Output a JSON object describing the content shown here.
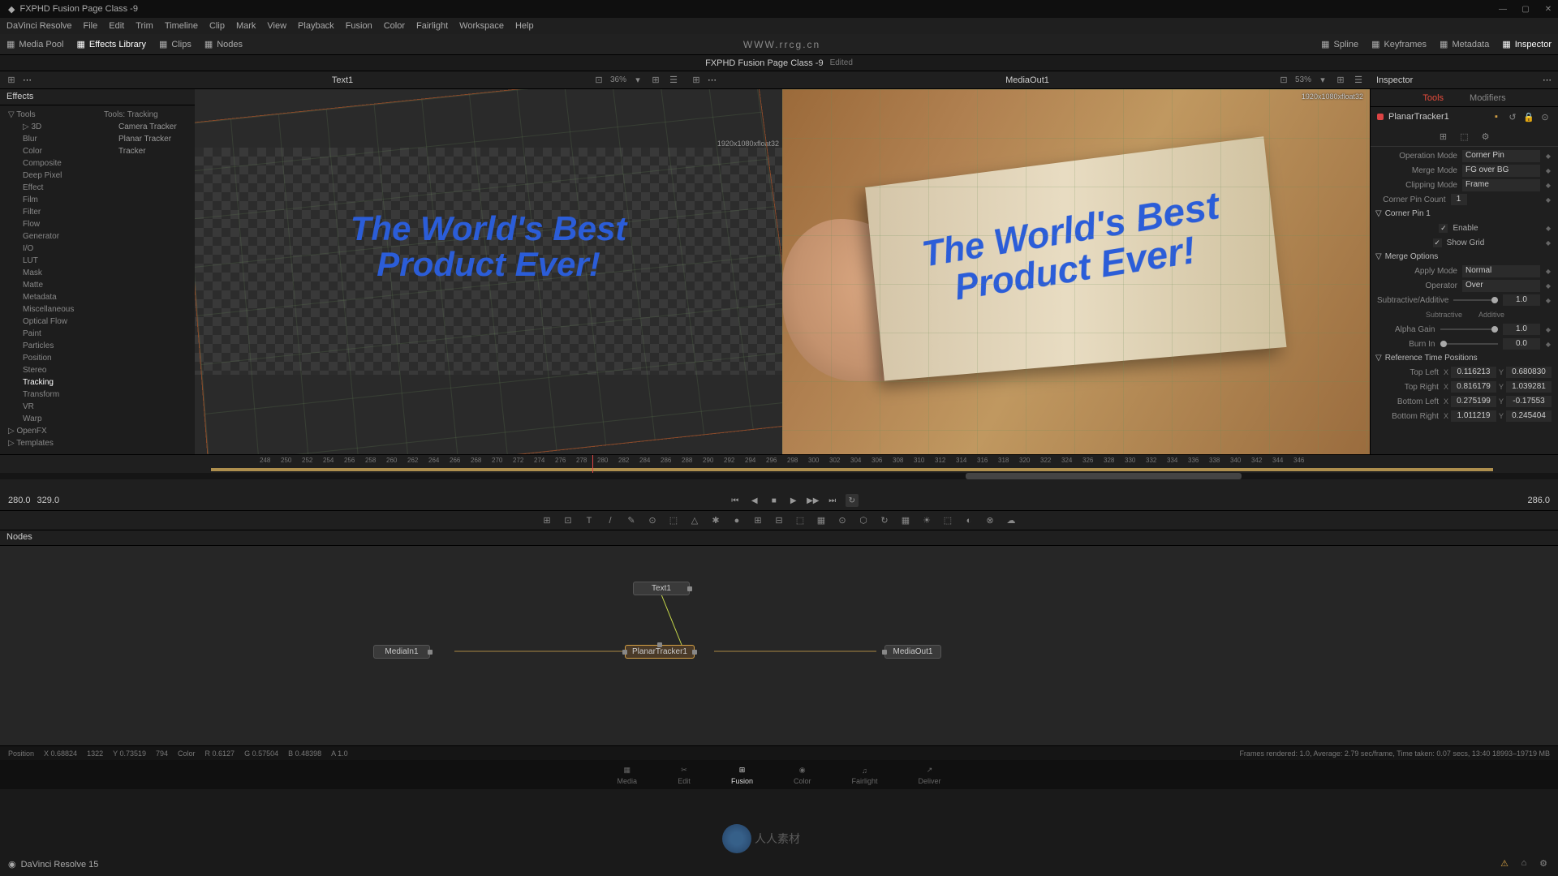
{
  "window": {
    "title": "FXPHD Fusion Page Class -9"
  },
  "menubar": [
    "DaVinci Resolve",
    "File",
    "Edit",
    "Trim",
    "Timeline",
    "Clip",
    "Mark",
    "View",
    "Playback",
    "Fusion",
    "Color",
    "Fairlight",
    "Workspace",
    "Help"
  ],
  "website": "WWW.rrcg.cn",
  "toolbar": {
    "left": [
      {
        "label": "Media Pool",
        "icon": "media-pool-icon"
      },
      {
        "label": "Effects Library",
        "icon": "effects-library-icon",
        "active": true
      },
      {
        "label": "Clips",
        "icon": "clips-icon"
      },
      {
        "label": "Nodes",
        "icon": "nodes-icon"
      }
    ],
    "center": "FXPHD Fusion Page Class -9",
    "edited": "Edited",
    "right": [
      {
        "label": "Spline",
        "icon": "spline-icon"
      },
      {
        "label": "Keyframes",
        "icon": "keyframes-icon"
      },
      {
        "label": "Metadata",
        "icon": "metadata-icon"
      },
      {
        "label": "Inspector",
        "icon": "inspector-icon",
        "active": true
      }
    ]
  },
  "viewer_header": {
    "left": {
      "percent": "36%",
      "title": "Text1"
    },
    "right": {
      "percent": "53%",
      "title": "MediaOut1"
    },
    "inspector_label": "Inspector"
  },
  "effects": {
    "header": "Effects",
    "tree": [
      {
        "label": "Tools",
        "lvl": 1,
        "expand": "▽"
      },
      {
        "label": "3D",
        "lvl": 2,
        "expand": "▷"
      },
      {
        "label": "Blur",
        "lvl": 2
      },
      {
        "label": "Color",
        "lvl": 2
      },
      {
        "label": "Composite",
        "lvl": 2
      },
      {
        "label": "Deep Pixel",
        "lvl": 2
      },
      {
        "label": "Effect",
        "lvl": 2
      },
      {
        "label": "Film",
        "lvl": 2
      },
      {
        "label": "Filter",
        "lvl": 2
      },
      {
        "label": "Flow",
        "lvl": 2
      },
      {
        "label": "Generator",
        "lvl": 2
      },
      {
        "label": "I/O",
        "lvl": 2
      },
      {
        "label": "LUT",
        "lvl": 2
      },
      {
        "label": "Mask",
        "lvl": 2
      },
      {
        "label": "Matte",
        "lvl": 2
      },
      {
        "label": "Metadata",
        "lvl": 2
      },
      {
        "label": "Miscellaneous",
        "lvl": 2
      },
      {
        "label": "Optical Flow",
        "lvl": 2
      },
      {
        "label": "Paint",
        "lvl": 2
      },
      {
        "label": "Particles",
        "lvl": 2
      },
      {
        "label": "Position",
        "lvl": 2
      },
      {
        "label": "Stereo",
        "lvl": 2
      },
      {
        "label": "Tracking",
        "lvl": 2,
        "selected": true
      },
      {
        "label": "Transform",
        "lvl": 2
      },
      {
        "label": "VR",
        "lvl": 2
      },
      {
        "label": "Warp",
        "lvl": 2
      },
      {
        "label": "OpenFX",
        "lvl": 1,
        "expand": "▷"
      },
      {
        "label": "Templates",
        "lvl": 1,
        "expand": "▷"
      }
    ],
    "list_header": "Tools: Tracking",
    "list": [
      "Camera Tracker",
      "Planar Tracker",
      "Tracker"
    ]
  },
  "viewer1": {
    "res": "1920x1080xfloat32",
    "text1": "The World's Best",
    "text2": "Product Ever!"
  },
  "viewer2": {
    "res": "1920x1080xfloat32",
    "text1": "The World's Best",
    "text2": "Product Ever!"
  },
  "inspector": {
    "tabs": [
      "Tools",
      "Modifiers"
    ],
    "node_name": "PlanarTracker1",
    "operation_mode": {
      "label": "Operation Mode",
      "value": "Corner Pin"
    },
    "merge_mode": {
      "label": "Merge Mode",
      "value": "FG over BG"
    },
    "clipping_mode": {
      "label": "Clipping Mode",
      "value": "Frame"
    },
    "corner_pin_count": {
      "label": "Corner Pin Count",
      "value": "1"
    },
    "section_corner": "Corner Pin 1",
    "enable": {
      "label": "Enable",
      "checked": true
    },
    "show_grid": {
      "label": "Show Grid",
      "checked": true
    },
    "section_merge": "Merge Options",
    "apply_mode": {
      "label": "Apply Mode",
      "value": "Normal"
    },
    "operator": {
      "label": "Operator",
      "value": "Over"
    },
    "sub_add": {
      "label": "Subtractive/Additive",
      "value": "1.0",
      "left": "Subtractive",
      "right": "Additive"
    },
    "alpha_gain": {
      "label": "Alpha Gain",
      "value": "1.0"
    },
    "burn_in": {
      "label": "Burn In",
      "value": "0.0"
    },
    "section_ref": "Reference Time Positions",
    "top_left": {
      "label": "Top Left",
      "x": "0.116213",
      "y": "0.680830"
    },
    "top_right": {
      "label": "Top Right",
      "x": "0.816179",
      "y": "1.039281"
    },
    "bottom_left": {
      "label": "Bottom Left",
      "x": "0.275199",
      "y": "-0.17553"
    },
    "bottom_right": {
      "label": "Bottom Right",
      "x": "1.011219",
      "y": "0.245404"
    }
  },
  "timeline": {
    "ticks": [
      "260",
      "266",
      "272",
      "284",
      "290",
      "296",
      "302",
      "308"
    ],
    "start_frame": "280.0",
    "range_end": "329.0",
    "current": "286.0"
  },
  "nodes_panel": {
    "header": "Nodes",
    "nodes": {
      "text1": "Text1",
      "mediain1": "MediaIn1",
      "planar": "PlanarTracker1",
      "mediaout1": "MediaOut1"
    }
  },
  "status": {
    "position": "Position",
    "x": "X 0.68824",
    "px1": "1322",
    "y": "Y 0.73519",
    "px2": "794",
    "color": "Color",
    "r": "R 0.6127",
    "g": "G 0.57504",
    "b": "B 0.48398",
    "a": "A 1.0",
    "render": "Frames rendered: 1.0,  Average: 2.79 sec/frame,  Time taken: 0.07 secs,  13:40  18993–19719 MB"
  },
  "pages": [
    "Media",
    "Edit",
    "Fusion",
    "Color",
    "Fairlight",
    "Deliver"
  ],
  "bottom_left": "DaVinci Resolve 15"
}
